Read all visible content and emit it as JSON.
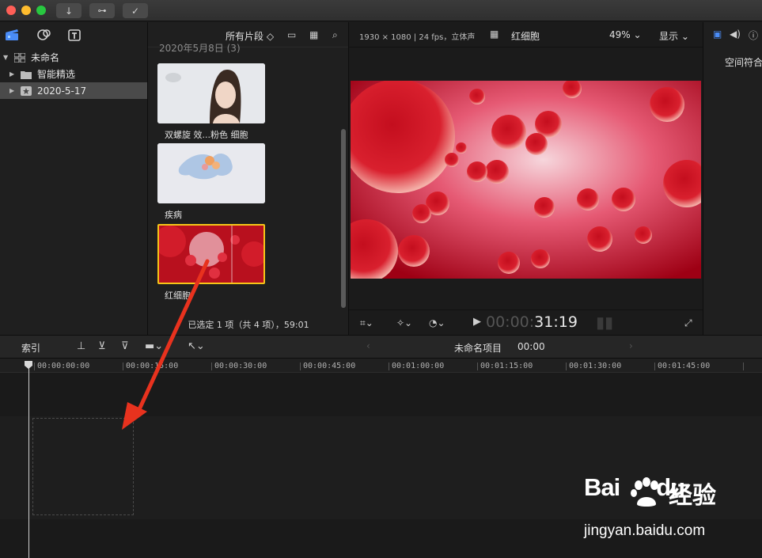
{
  "titlebar": {
    "buttons": [
      "download-icon",
      "key-icon",
      "check-circle-icon"
    ]
  },
  "library": {
    "items": [
      {
        "label": "未命名",
        "icon": "library-grid-icon",
        "expanded": true,
        "selected": false
      },
      {
        "label": "智能精选",
        "icon": "folder-icon",
        "expanded": false,
        "selected": false
      },
      {
        "label": "2020-5-17",
        "icon": "event-star-icon",
        "expanded": false,
        "selected": true
      }
    ]
  },
  "browser": {
    "filter": "所有片段 ◇",
    "date_header": "2020年5月8日 (3)",
    "clips": [
      {
        "name": "双螺旋 效...粉色 细胞",
        "selected": false
      },
      {
        "name": "疾病",
        "selected": false
      },
      {
        "name": "红细胞",
        "selected": true
      }
    ],
    "status": "已选定 1 项（共 4 项），59:01"
  },
  "viewer": {
    "format_info": "1930 × 1080 | 24 fps，立体声",
    "clip_name": "红细胞",
    "zoom": "49% ⌄",
    "display_menu": "显示 ⌄",
    "timecode_dim": "00:00:",
    "timecode_bright": "31:19"
  },
  "inspector": {
    "label": "空间符合"
  },
  "timeline_toolbar": {
    "index_label": "索引",
    "project_name": "未命名项目",
    "project_duration": "00:00"
  },
  "timeline": {
    "ruler_labels": [
      "00:00:00:00",
      "00:00:15:00",
      "00:00:30:00",
      "00:00:45:00",
      "00:01:00:00",
      "00:01:15:00",
      "00:01:30:00",
      "00:01:45:00"
    ]
  },
  "watermark": {
    "logo": "Bai",
    "logo_suffix": "du",
    "cn": "经验",
    "url": "jingyan.baidu.com"
  },
  "colors": {
    "selection_yellow": "#f5c518",
    "arrow_red": "#e8321e",
    "accent_blue": "#3b82f6"
  }
}
